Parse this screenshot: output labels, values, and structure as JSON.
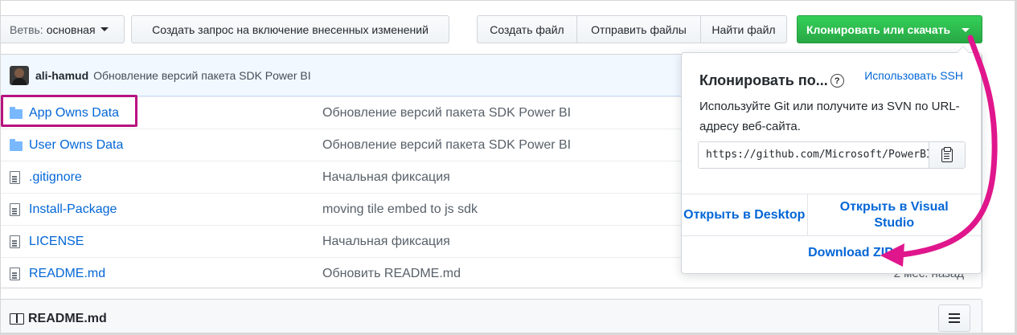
{
  "toolbar": {
    "branch_label": "Ветвь:",
    "branch_value": "основная",
    "pull_request_label": "Создать запрос на включение внесенных изменений",
    "create_file_label": "Создать файл",
    "upload_files_label": "Отправить файлы",
    "find_file_label": "Найти файл",
    "clone_label": "Клонировать или скачать"
  },
  "commit": {
    "author": "ali-hamud",
    "message": "Обновление версий пакета SDK Power BI"
  },
  "files": [
    {
      "type": "folder",
      "name": "App Owns Data",
      "message": "Обновление версий пакета SDK Power BI",
      "age": ""
    },
    {
      "type": "folder",
      "name": "User Owns Data",
      "message": "Обновление версий пакета SDK Power BI",
      "age": ""
    },
    {
      "type": "file",
      "name": ".gitignore",
      "message": "Начальная фиксация",
      "age": ""
    },
    {
      "type": "file",
      "name": "Install-Package",
      "message": "moving tile embed to js sdk",
      "age": ""
    },
    {
      "type": "file",
      "name": "LICENSE",
      "message": "Начальная фиксация",
      "age": ""
    },
    {
      "type": "file",
      "name": "README.md",
      "message": "Обновить README.md",
      "age": "2 мес. назад"
    }
  ],
  "readme": {
    "title": "README.md"
  },
  "clone_dropdown": {
    "title": "Клонировать по...",
    "help_symbol": "?",
    "ssh_link": "Использовать SSH",
    "description": "Используйте Git или получите из SVN по URL-адресу веб-сайта.",
    "url": "https://github.com/Microsoft/PowerBI-Developer-Samples.git",
    "open_desktop": "Открыть в Desktop",
    "open_vs": "Открыть в Visual Studio",
    "download_zip": "Download ZIP"
  },
  "colors": {
    "accent_green": "#28a745",
    "link_blue": "#0366d6",
    "highlight_magenta": "#e0168c"
  }
}
